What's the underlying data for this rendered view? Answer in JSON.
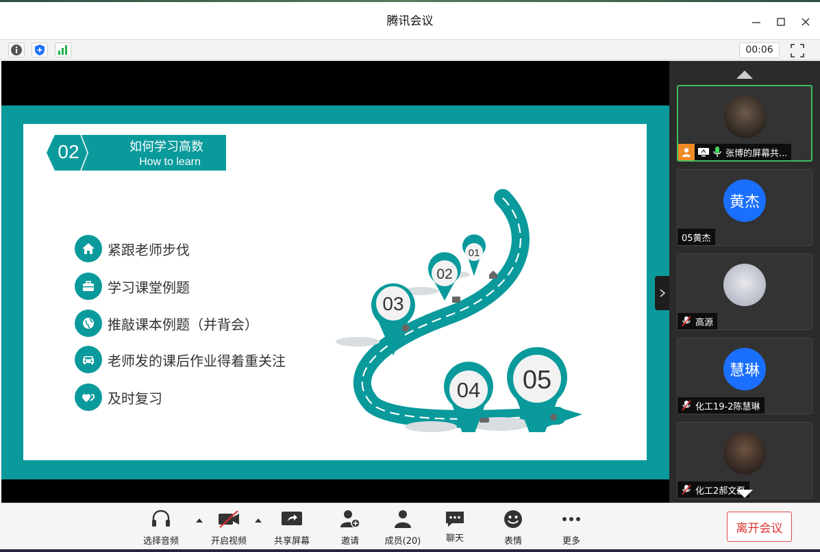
{
  "window": {
    "title": "腾讯会议"
  },
  "status": {
    "timer": "00:06"
  },
  "slide": {
    "section_number": "02",
    "section_title": "如何学习高数",
    "section_subtitle": "How to learn",
    "bullets": [
      {
        "icon": "home-icon",
        "text": "紧跟老师步伐"
      },
      {
        "icon": "briefcase-icon",
        "text": "学习课堂例题"
      },
      {
        "icon": "globe-icon",
        "text": "推敲课本例题（并背会）"
      },
      {
        "icon": "car-icon",
        "text": "老师发的课后作业得着重关注"
      },
      {
        "icon": "hearts-icon",
        "text": "及时复习"
      }
    ],
    "roadmap_pins": [
      "01",
      "02",
      "03",
      "04",
      "05"
    ]
  },
  "participants": [
    {
      "name": "张博的屏幕共...",
      "avatar_text": "",
      "sharing": true
    },
    {
      "name": "05黄杰",
      "avatar_text": "黄杰",
      "muted": false
    },
    {
      "name": "高源",
      "avatar_text": "",
      "muted": true
    },
    {
      "name": "化工19-2陈慧琳",
      "avatar_text": "慧琳",
      "muted": true
    },
    {
      "name": "化工2郝文磊",
      "avatar_text": "",
      "muted": true
    }
  ],
  "toolbar": {
    "audio": "选择音频",
    "video": "开启视频",
    "share": "共享屏幕",
    "invite": "邀请",
    "members": "成员(20)",
    "chat": "聊天",
    "emoji": "表情",
    "more": "更多",
    "leave": "离开会议"
  },
  "colors": {
    "teal": "#0a9a9c",
    "leave": "#e03030",
    "avatar_blue": "#1a6fff",
    "active_border": "#3fbf5f"
  }
}
